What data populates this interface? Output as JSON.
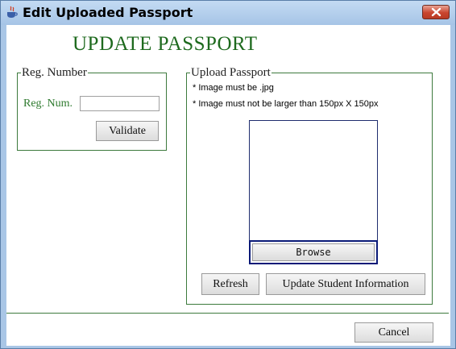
{
  "window": {
    "title": "Edit Uploaded Passport",
    "app_icon": "java-cup-icon",
    "close_icon": "close-icon"
  },
  "heading": "UPDATE PASSPORT",
  "reg_group": {
    "legend": "Reg. Number",
    "field_label": "Reg. Num.",
    "field_value": "",
    "validate_label": "Validate"
  },
  "upload_group": {
    "legend": "Upload Passport",
    "notes": [
      "* Image must be .jpg",
      "* Image must not be larger than 150px X 150px"
    ],
    "browse_label": "Browse",
    "refresh_label": "Refresh",
    "update_label": "Update Student Information"
  },
  "footer": {
    "cancel_label": "Cancel"
  },
  "colors": {
    "heading": "#1e6a1e",
    "border": "#3d7a3d",
    "titlebar": "#a9c6e6",
    "close": "#c9452f"
  }
}
